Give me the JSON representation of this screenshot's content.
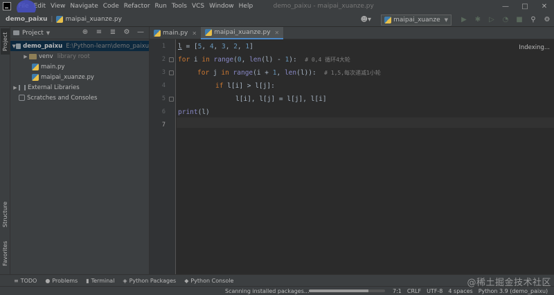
{
  "menubar": {
    "items": [
      "File",
      "Edit",
      "View",
      "Navigate",
      "Code",
      "Refactor",
      "Run",
      "Tools",
      "VCS",
      "Window",
      "Help"
    ],
    "window_title": "demo_paixu - maipai_xuanze.py"
  },
  "navbar": {
    "project": "demo_paixu",
    "file": "maipai_xuanze.py",
    "run_config": "maipai_xuanze"
  },
  "left_strip": {
    "project_tab": "Project",
    "structure_tab": "Structure",
    "favorites_tab": "Favorites"
  },
  "project_panel": {
    "title": "Project",
    "root_name": "demo_paixu",
    "root_path": "E:\\Python-learn\\demo_paixu",
    "venv_name": "venv",
    "venv_note": "library root",
    "file1": "main.py",
    "file2": "maipai_xuanze.py",
    "external": "External Libraries",
    "scratches": "Scratches and Consoles"
  },
  "tabs": [
    "main.py",
    "maipai_xuanze.py"
  ],
  "editor": {
    "status": "Indexing...",
    "line_numbers": [
      "1",
      "2",
      "3",
      "4",
      "5",
      "6",
      "7"
    ],
    "l1": {
      "a": "l",
      "b": " = [",
      "c": "5",
      "d": ", ",
      "e": "4",
      "f": ", ",
      "g": "3",
      "h": ", ",
      "i": "2",
      "j": ", ",
      "k": "1",
      "m": "]"
    },
    "l2": {
      "kw1": "for",
      "a": " i ",
      "kw2": "in",
      "b": " ",
      "fn1": "range",
      "c": "(",
      "n1": "0",
      "d": ", ",
      "fn2": "len",
      "e": "(l) - ",
      "n2": "1",
      "f": "):  ",
      "cm": "# 0,4 循环4大轮"
    },
    "l3": {
      "kw1": "for",
      "a": " j ",
      "kw2": "in",
      "b": " ",
      "fn1": "range",
      "c": "(i + ",
      "n1": "1",
      "d": ", ",
      "fn2": "len",
      "e": "(l)):  ",
      "cm": "# 1,5,每次递减1小轮"
    },
    "l4": {
      "kw1": "if",
      "a": " l[i] > l[j]:"
    },
    "l5": {
      "a": "l[i], l[j] = l[j], l[i]"
    },
    "l6": {
      "fn": "print",
      "a": "(l)"
    }
  },
  "bottom_tools": {
    "todo": "TODO",
    "problems": "Problems",
    "terminal": "Terminal",
    "packages": "Python Packages",
    "console": "Python Console"
  },
  "status": {
    "message": "Scanning installed packages...",
    "progress": 0.78,
    "position": "7:1",
    "line_sep": "CRLF",
    "encoding": "UTF-8",
    "indent": "4 spaces",
    "interpreter": "Python 3.9 (demo_paixu)",
    "watermark": "@稀土掘金技术社区"
  },
  "colors": {
    "keyword": "#cc7832",
    "builtin": "#8888c6",
    "number": "#6897bb",
    "comment": "#808080",
    "text": "#a9b7c6"
  }
}
